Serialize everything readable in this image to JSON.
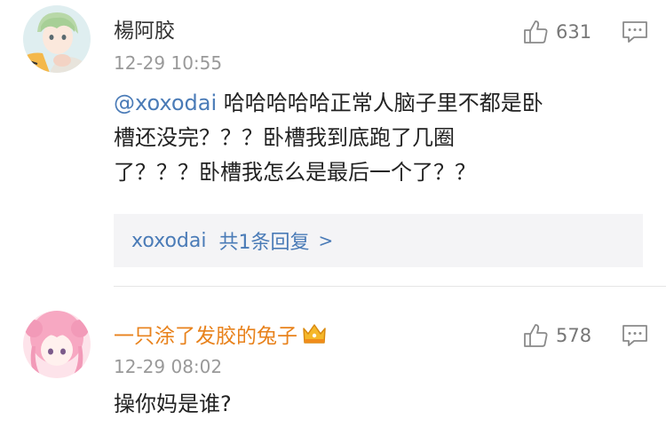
{
  "comments": [
    {
      "username": "楊阿胶",
      "timestamp": "12-29 10:55",
      "likes": "631",
      "mention": "@xoxodai",
      "text_lines": [
        " 哈哈哈哈哈正常人脑子里不都是卧",
        "槽还没完？？？卧槽我到底跑了几圈",
        "了？？？卧槽我怎么是最后一个了？？"
      ],
      "replies": {
        "name": "xoxodai",
        "count_label": "共1条回复",
        "chevron": ">"
      },
      "username_color": "#333333"
    },
    {
      "username": "一只涂了发胶的兔子",
      "timestamp": "12-29 08:02",
      "likes": "578",
      "text": "操你妈是谁?",
      "username_color": "#e8821c",
      "badge": "vip-crown-icon"
    }
  ],
  "colors": {
    "link": "#4a7bb7",
    "timestamp": "#999999",
    "vip_name": "#e8821c",
    "reply_bg": "#f4f4f6"
  }
}
